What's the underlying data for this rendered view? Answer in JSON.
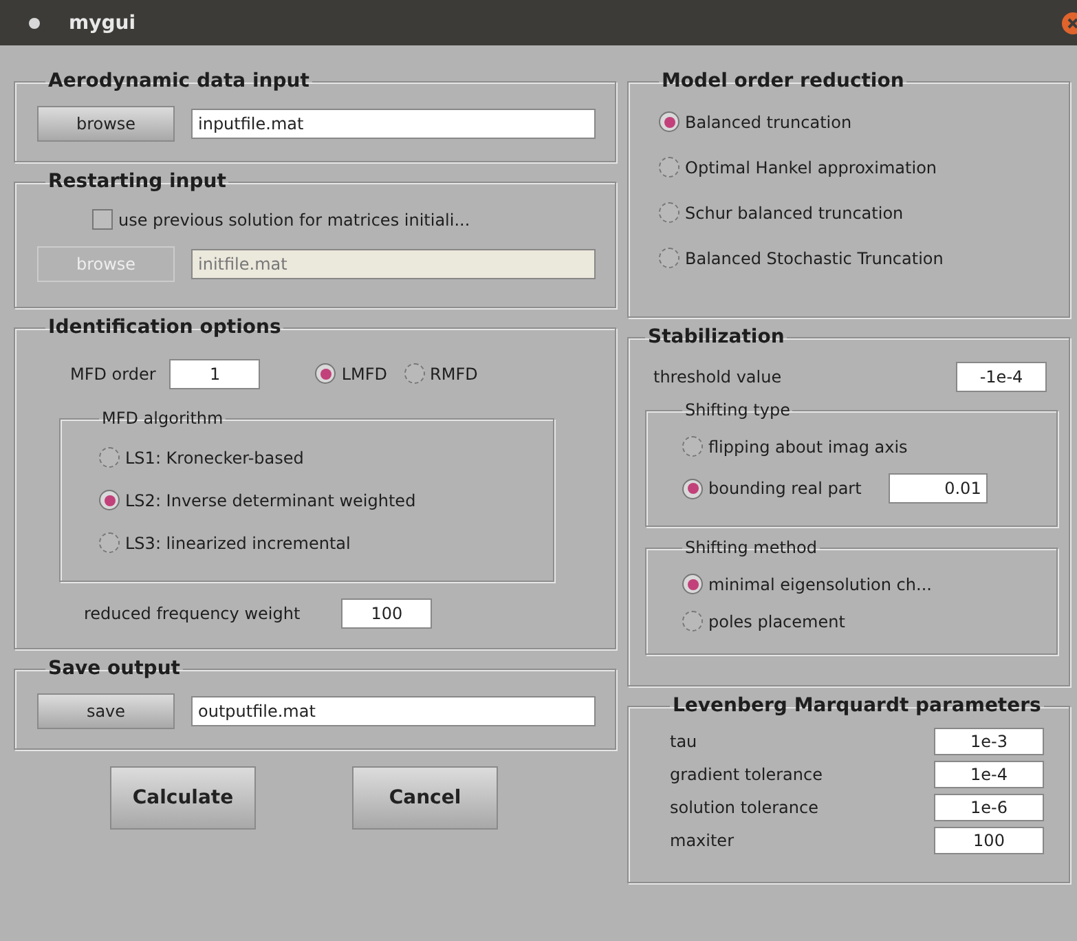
{
  "window": {
    "title": "mygui"
  },
  "aerodynamic_data_input": {
    "title": "Aerodynamic data input",
    "button": {
      "label": "browse",
      "disabled": false
    },
    "field": {
      "value": "inputfile.mat",
      "disabled": false
    }
  },
  "restarting_input": {
    "title": "Restarting input",
    "checkbox": {
      "label": "use previous solution for matrices initiali...",
      "checked": false
    },
    "button": {
      "label": "browse",
      "disabled": true
    },
    "field": {
      "value": "initfile.mat",
      "disabled": true
    }
  },
  "identification_options": {
    "title": "Identification options",
    "mfd_order": {
      "label": "MFD order",
      "value": "1"
    },
    "fraction_type": [
      {
        "label": "LMFD",
        "selected": true
      },
      {
        "label": "RMFD",
        "selected": false
      }
    ],
    "mfd_algorithm": {
      "title": "MFD algorithm",
      "options": [
        {
          "label": "LS1: Kronecker-based",
          "selected": false
        },
        {
          "label": "LS2: Inverse determinant weighted",
          "selected": true
        },
        {
          "label": "LS3: linearized incremental",
          "selected": false
        }
      ]
    },
    "frequency_weight": {
      "label": "reduced frequency weight",
      "value": "100"
    }
  },
  "save_output": {
    "title": "Save output",
    "button": {
      "label": "save",
      "disabled": false
    },
    "field": {
      "value": "outputfile.mat",
      "disabled": false
    }
  },
  "buttons": [
    "Calculate",
    "Cancel"
  ],
  "model_order_reduction": {
    "title": "Model order reduction",
    "options": [
      {
        "label": "Balanced truncation",
        "selected": true
      },
      {
        "label": "Optimal Hankel approximation",
        "selected": false
      },
      {
        "label": "Schur balanced truncation",
        "selected": false
      },
      {
        "label": "Balanced Stochastic Truncation",
        "selected": false
      }
    ]
  },
  "stabilization": {
    "title": "Stabilization",
    "threshold": {
      "label": "threshold value",
      "value": "-1e-4"
    },
    "shifting_type": {
      "title": "Shifting type",
      "options": [
        {
          "label": "flipping about imag axis",
          "selected": false
        },
        {
          "label": "bounding real part",
          "selected": true,
          "value": "0.01"
        }
      ]
    },
    "shifting_method": {
      "title": "Shifting method",
      "options": [
        {
          "label": "minimal eigensolution ch...",
          "selected": true
        },
        {
          "label": "poles placement",
          "selected": false
        }
      ]
    }
  },
  "lm_parameters": {
    "title": "Levenberg  Marquardt parameters",
    "fields": [
      {
        "label": "tau",
        "value": "1e-3"
      },
      {
        "label": "gradient tolerance",
        "value": "1e-4"
      },
      {
        "label": "solution tolerance",
        "value": "1e-6"
      },
      {
        "label": "maxiter",
        "value": "100"
      }
    ]
  }
}
